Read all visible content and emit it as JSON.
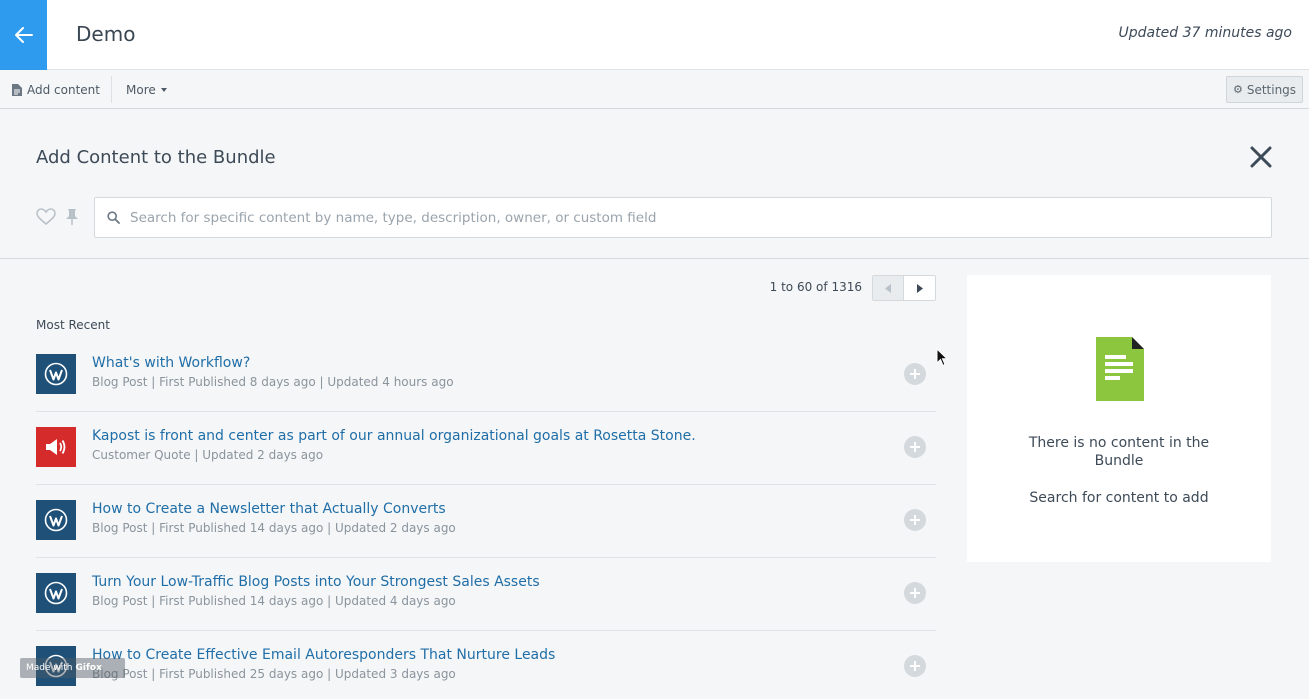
{
  "header": {
    "title": "Demo",
    "updated": "Updated 37 minutes ago"
  },
  "toolbar": {
    "add_content": "Add content",
    "more": "More",
    "settings": "Settings"
  },
  "panel": {
    "title": "Add Content to the Bundle",
    "search_placeholder": "Search for specific content by name, type, description, owner, or custom field"
  },
  "pager": {
    "start": "1",
    "to": "to",
    "end": "60",
    "of": "of",
    "total": "1316"
  },
  "section_label": "Most Recent",
  "items": [
    {
      "icon": "wordpress-icon",
      "color": "#1e5078",
      "name": "What's with Workflow?",
      "meta": "Blog Post | First Published 8 days ago | Updated 4 hours ago"
    },
    {
      "icon": "megaphone-icon",
      "color": "#d52b2b",
      "name": "Kapost is front and center as part of our annual organizational goals at Rosetta Stone.",
      "meta": "Customer Quote | Updated 2 days ago"
    },
    {
      "icon": "wordpress-icon",
      "color": "#1e5078",
      "name": "How to Create a Newsletter that Actually Converts",
      "meta": "Blog Post | First Published 14 days ago | Updated 2 days ago"
    },
    {
      "icon": "wordpress-icon",
      "color": "#1e5078",
      "name": "Turn Your Low-Traffic Blog Posts into Your Strongest Sales Assets",
      "meta": "Blog Post | First Published 14 days ago | Updated 4 days ago"
    },
    {
      "icon": "wordpress-icon",
      "color": "#1e5078",
      "name": "How to Create Effective Email Autoresponders That Nurture Leads",
      "meta": "Blog Post | First Published 25 days ago | Updated 3 days ago"
    }
  ],
  "bundle": {
    "empty_title": "There is no content in the Bundle",
    "empty_sub": "Search for content to add"
  },
  "watermark": {
    "made_with": "Made with",
    "brand": "Gifox"
  },
  "colors": {
    "accent": "#2f9bef",
    "link": "#1f6ea8",
    "doc_green": "#8cc63f"
  }
}
